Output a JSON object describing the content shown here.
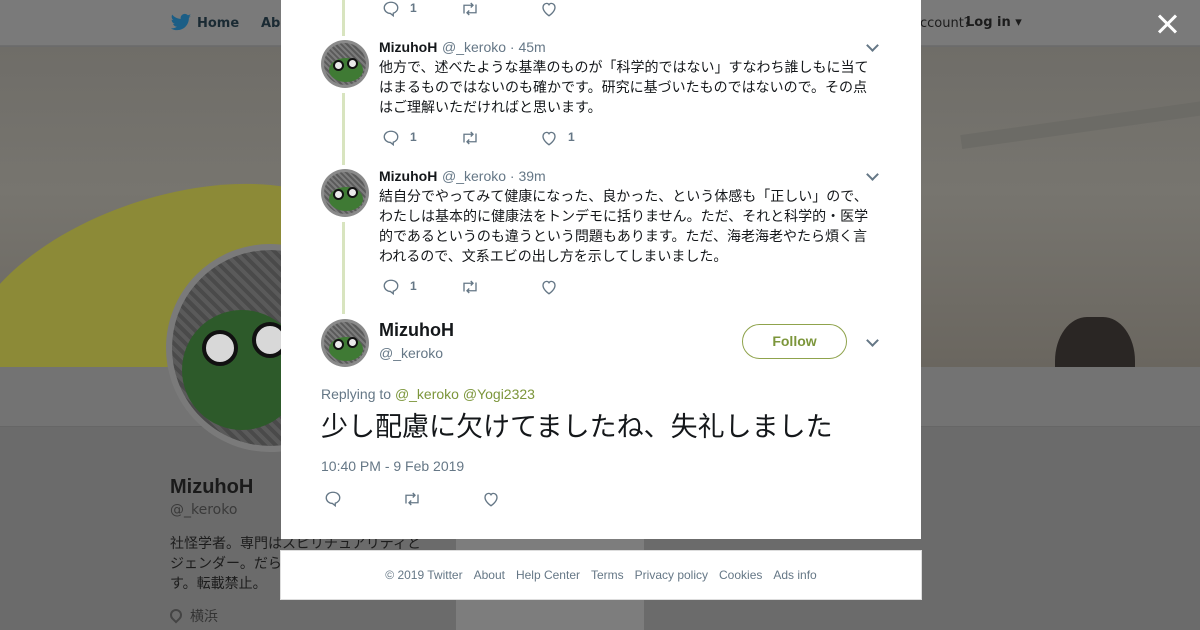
{
  "background": {
    "nav": {
      "home": "Home",
      "about": "Abo",
      "account_question": "account?",
      "login": "Log in"
    },
    "profile": {
      "name": "MizuhoH",
      "handle": "@_keroko",
      "bio": "社怪学者。専門はスピリチュアリティとジェンダー。だら　　　　　　　　　　す。転載禁止。",
      "location": "横浜",
      "card_text": "Ads info"
    }
  },
  "thread": [
    {
      "name": "MizuhoH",
      "handle": "@_keroko",
      "time": "",
      "text": "",
      "reply_count": "1",
      "retweet_count": "",
      "like_count": ""
    },
    {
      "name": "MizuhoH",
      "handle": "@_keroko",
      "time": "· 45m",
      "text": "他方で、述べたような基準のものが「科学的ではない」すなわち誰しもに当てはまるものではないのも確かです。研究に基づいたものではないので。その点はご理解いただければと思います。",
      "reply_count": "1",
      "retweet_count": "",
      "like_count": "1"
    },
    {
      "name": "MizuhoH",
      "handle": "@_keroko",
      "time": "· 39m",
      "text": "結自分でやってみて健康になった、良かった、という体感も「正しい」ので、わたしは基本的に健康法をトンデモに括りません。ただ、それと科学的・医学的であるというのも違うという問題もあります。ただ、海老海老やたら煩く言われるので、文系エビの出し方を示してしまいました。",
      "reply_count": "1",
      "retweet_count": "",
      "like_count": ""
    }
  ],
  "main_tweet": {
    "name": "MizuhoH",
    "handle": "@_keroko",
    "follow_label": "Follow",
    "replying_label": "Replying to",
    "mentions": [
      "@_keroko",
      "@Yogi2323"
    ],
    "text": "少し配慮に欠けてましたね、失礼しました",
    "timestamp": "10:40 PM - 9 Feb 2019"
  },
  "footer": [
    "© 2019 Twitter",
    "About",
    "Help Center",
    "Terms",
    "Privacy policy",
    "Cookies",
    "Ads info"
  ],
  "colors": {
    "accent": "#7c963b",
    "thread_line": "#d8e4bf",
    "muted": "#657786"
  },
  "icons": [
    "twitter-bird-icon",
    "close-icon",
    "reply-icon",
    "retweet-icon",
    "like-icon",
    "chevron-down-icon",
    "location-pin-icon"
  ]
}
